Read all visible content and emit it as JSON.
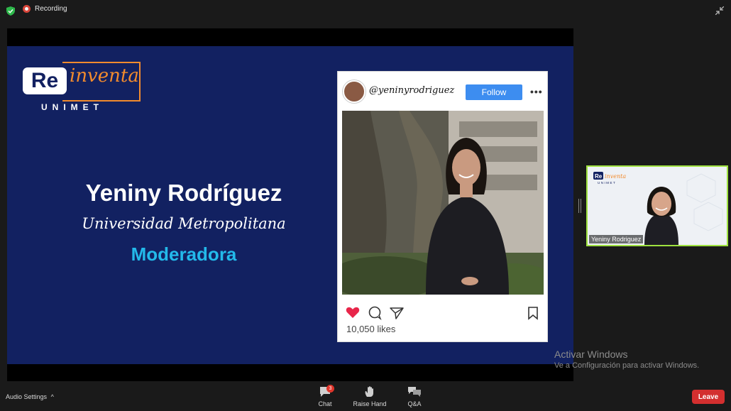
{
  "topbar": {
    "recording_label": "Recording"
  },
  "slide": {
    "logo": {
      "re": "Re",
      "inventa": "inventa",
      "unimet": "UNIMET"
    },
    "speaker_name": "Yeniny Rodríguez",
    "university": "Universidad Metropolitana",
    "role": "Moderadora",
    "instagram": {
      "handle": "@yeninyrodriguez",
      "follow_label": "Follow",
      "more": "•••",
      "likes": "10,050 likes"
    }
  },
  "self_view": {
    "name": "Yeniny Rodriguez",
    "logo_re": "Re",
    "logo_inventa": "inventa",
    "logo_unimet": "UNIMET"
  },
  "watermark": {
    "title": "Activar Windows",
    "subtitle": "Ve a Configuración para activar Windows."
  },
  "bottombar": {
    "audio_settings": "Audio Settings",
    "chat": "Chat",
    "chat_badge": "3",
    "raise_hand": "Raise Hand",
    "qa": "Q&A",
    "leave": "Leave"
  },
  "colors": {
    "slide_bg": "#122161",
    "accent_orange": "#f28b2d",
    "role_cyan": "#23b9ea",
    "follow_blue": "#3d8df0",
    "leave_red": "#d32f2f",
    "active_speaker_border": "#9fe23f"
  }
}
